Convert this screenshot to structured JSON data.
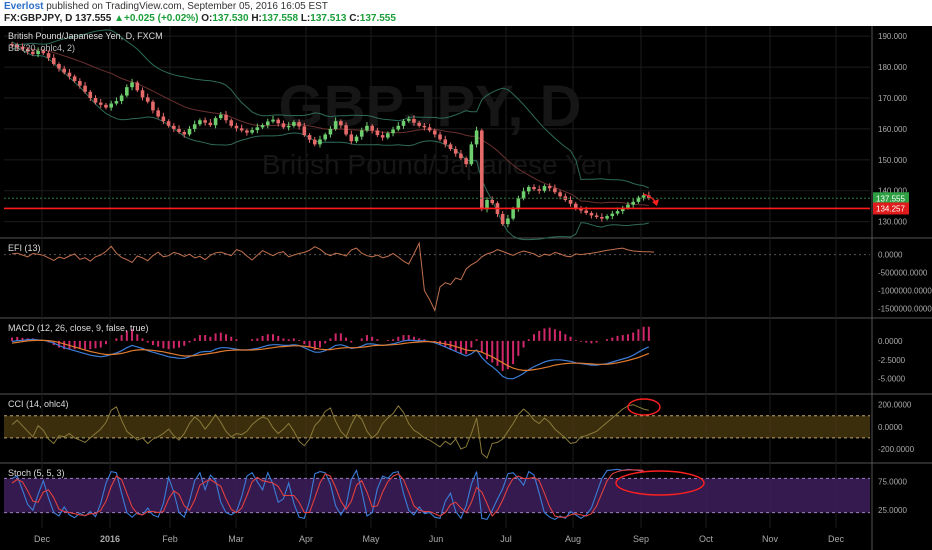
{
  "header": {
    "author": "Everlost",
    "published": "published on TradingView.com, September 05, 2016 16:05 EST",
    "symbol": "FX:GBPJPY, D",
    "last": "137.555",
    "change_arrow": "▲",
    "change": "+0.025 (+0.02%)",
    "o_label": "O:",
    "o": "137.530",
    "h_label": "H:",
    "h": "137.558",
    "l_label": "L:",
    "l": "137.513",
    "c_label": "C:",
    "c": "137.555"
  },
  "colors": {
    "background": "#000000",
    "up_candle": "#6fcf6f",
    "down_candle": "#e56a6a",
    "support_line": "#ff1a1a",
    "price_badge": "#2ea043",
    "support_badge": "#e01b1b",
    "macd_line": "#3b7dd8",
    "signal_line": "#e07a2e",
    "hist": "#d0286a",
    "cci_band": "#4a3a10",
    "stoch_band": "#3d1f5c",
    "annotation": "#ff2020"
  },
  "chart_data": [
    {
      "type": "candlestick",
      "title": "British Pound/Japanese Yen, D, FXCM",
      "watermark_symbol": "GBPJPY, D",
      "watermark_name": "British Pound/Japanese Yen",
      "indicator_label": "BB (20, ohlc4, 2)",
      "x_ticks": [
        "Dec",
        "2016",
        "Feb",
        "Mar",
        "Apr",
        "May",
        "Jun",
        "Jul",
        "Aug",
        "Sep",
        "Oct",
        "Nov",
        "Dec"
      ],
      "y_ticks": [
        "190.000",
        "180.000",
        "170.000",
        "160.000",
        "150.000",
        "140.000",
        "130.000"
      ],
      "ylim": [
        126,
        192
      ],
      "last_price_label": "137.555",
      "support_level": 134.257,
      "support_label": "134.257",
      "close": [
        187,
        186.5,
        185.8,
        185,
        184.2,
        185.2,
        184.5,
        183,
        181,
        179.5,
        178.2,
        177,
        175.5,
        174,
        172,
        170,
        168.5,
        167.8,
        166.9,
        168.2,
        169,
        170.8,
        173.5,
        175,
        172.5,
        170.2,
        168.8,
        166,
        164,
        162.5,
        161,
        160,
        159,
        158.2,
        160,
        161.5,
        162.8,
        162,
        161.2,
        163.5,
        164.6,
        162.8,
        161,
        160.2,
        159.5,
        158.8,
        159.6,
        160.5,
        161.2,
        162.4,
        163,
        161.8,
        160.5,
        161,
        162.2,
        160.8,
        158,
        156.5,
        155,
        156.6,
        158.2,
        160,
        162.5,
        161.2,
        158.2,
        156,
        157.5,
        159.5,
        161,
        159.5,
        158,
        157.2,
        158.6,
        159.8,
        161,
        162.6,
        163.2,
        162,
        161,
        160.5,
        159.5,
        158.2,
        156.6,
        155,
        153.5,
        152,
        150.5,
        148.6,
        155,
        159.5,
        134,
        137,
        136,
        132.5,
        129.2,
        131,
        134.2,
        137.5,
        139.8,
        141.2,
        140.5,
        140,
        141.5,
        140.8,
        139.5,
        138.2,
        137,
        135.8,
        134.2,
        133.6,
        132.8,
        132,
        131.5,
        131,
        131.8,
        132.6,
        133.4,
        134.5,
        135.5,
        136.4,
        137.8,
        138.5,
        137.555
      ]
    },
    {
      "type": "line",
      "title": "EFI (13)",
      "y_ticks": [
        "0.0000",
        "-500000.0000",
        "-1000000.0000",
        "-1500000.0000"
      ],
      "ylim": [
        -1650000,
        350000
      ],
      "values": [
        20000,
        40000,
        -10000,
        -60000,
        30000,
        10000,
        -20000,
        -90000,
        -160000,
        -70000,
        -110000,
        -40000,
        20000,
        -130000,
        -90000,
        -180000,
        -60000,
        -10000,
        90000,
        230000,
        40000,
        -80000,
        -140000,
        -220000,
        -40000,
        -90000,
        -170000,
        -30000,
        70000,
        -60000,
        -30000,
        60000,
        20000,
        -50000,
        10000,
        -90000,
        -50000,
        -140000,
        -20000,
        50000,
        70000,
        20000,
        -30000,
        140000,
        90000,
        -40000,
        -150000,
        -20000,
        110000,
        40000,
        -30000,
        50000,
        80000,
        -60000,
        -10000,
        30000,
        60000,
        120000,
        220000,
        150000,
        30000,
        -30000,
        40000,
        10000,
        -40000,
        130000,
        180000,
        40000,
        -30000,
        -60000,
        -10000,
        -90000,
        -50000,
        30000,
        -70000,
        -180000,
        -260000,
        20000,
        320000,
        -1000000,
        -1250000,
        -1550000,
        -900000,
        -780000,
        -830000,
        -650000,
        -700000,
        -400000,
        -280000,
        -200000,
        -60000,
        20000,
        60000,
        140000,
        90000,
        30000,
        -20000,
        50000,
        100000,
        60000,
        20000,
        -60000,
        10000,
        -20000,
        60000,
        20000,
        -40000,
        -60000,
        20000,
        0,
        20000,
        40000,
        60000,
        90000,
        120000,
        140000,
        160000,
        180000,
        130000,
        100000,
        90000,
        80000,
        80000,
        70000
      ]
    },
    {
      "type": "line",
      "title": "MACD (12, 26, close, 9, false, true)",
      "y_ticks": [
        "0.0000",
        "-2.5000",
        "-5.0000"
      ],
      "ylim": [
        -6.5,
        2.5
      ],
      "series": [
        {
          "name": "MACD",
          "values": [
            -0.1,
            0.04,
            0.08,
            0.16,
            0.2,
            0.12,
            0.08,
            -0.06,
            -0.3,
            -0.6,
            -0.9,
            -1.1,
            -1.3,
            -1.5,
            -1.7,
            -1.9,
            -2.0,
            -2.1,
            -2.0,
            -1.8,
            -1.6,
            -1.3,
            -0.9,
            -0.6,
            -0.8,
            -1.0,
            -1.3,
            -1.5,
            -1.7,
            -1.9,
            -2.1,
            -2.2,
            -2.3,
            -2.3,
            -2.1,
            -1.8,
            -1.5,
            -1.4,
            -1.4,
            -1.1,
            -0.9,
            -0.9,
            -1.0,
            -1.1,
            -1.2,
            -1.2,
            -1.1,
            -1.0,
            -0.8,
            -0.6,
            -0.5,
            -0.5,
            -0.6,
            -0.6,
            -0.5,
            -0.6,
            -0.9,
            -1.2,
            -1.5,
            -1.5,
            -1.3,
            -1.0,
            -0.6,
            -0.5,
            -0.7,
            -1.0,
            -0.9,
            -0.7,
            -0.4,
            -0.4,
            -0.5,
            -0.6,
            -0.5,
            -0.4,
            -0.2,
            0.0,
            0.1,
            0.05,
            0.0,
            0.0,
            -0.1,
            -0.25,
            -0.5,
            -0.8,
            -1.1,
            -1.4,
            -1.7,
            -2.0,
            -1.7,
            -1.2,
            -2.2,
            -2.9,
            -3.4,
            -4.0,
            -4.7,
            -5.0,
            -5.0,
            -4.7,
            -4.3,
            -3.8,
            -3.4,
            -3.1,
            -2.8,
            -2.6,
            -2.5,
            -2.5,
            -2.6,
            -2.7,
            -2.9,
            -3.0,
            -3.1,
            -3.2,
            -3.2,
            -3.1,
            -3.0,
            -2.8,
            -2.6,
            -2.4,
            -2.2,
            -1.9,
            -1.5,
            -1.1,
            -0.8
          ]
        },
        {
          "name": "Signal",
          "values": [
            -0.3,
            -0.2,
            -0.1,
            0.0,
            0.05,
            0.06,
            0.06,
            0.04,
            -0.05,
            -0.2,
            -0.4,
            -0.6,
            -0.8,
            -1.0,
            -1.2,
            -1.4,
            -1.55,
            -1.7,
            -1.8,
            -1.8,
            -1.75,
            -1.65,
            -1.5,
            -1.3,
            -1.2,
            -1.15,
            -1.2,
            -1.25,
            -1.35,
            -1.45,
            -1.6,
            -1.75,
            -1.9,
            -2.0,
            -2.0,
            -1.95,
            -1.85,
            -1.75,
            -1.65,
            -1.55,
            -1.4,
            -1.3,
            -1.25,
            -1.2,
            -1.2,
            -1.2,
            -1.2,
            -1.15,
            -1.1,
            -1.0,
            -0.9,
            -0.8,
            -0.75,
            -0.7,
            -0.65,
            -0.65,
            -0.7,
            -0.8,
            -0.95,
            -1.1,
            -1.15,
            -1.15,
            -1.05,
            -0.95,
            -0.9,
            -0.9,
            -0.9,
            -0.85,
            -0.75,
            -0.65,
            -0.6,
            -0.6,
            -0.55,
            -0.5,
            -0.45,
            -0.35,
            -0.25,
            -0.2,
            -0.15,
            -0.1,
            -0.1,
            -0.15,
            -0.25,
            -0.4,
            -0.55,
            -0.75,
            -0.95,
            -1.2,
            -1.3,
            -1.3,
            -1.5,
            -1.8,
            -2.1,
            -2.5,
            -2.9,
            -3.3,
            -3.6,
            -3.8,
            -3.9,
            -3.9,
            -3.8,
            -3.7,
            -3.55,
            -3.4,
            -3.2,
            -3.1,
            -3.0,
            -2.95,
            -2.95,
            -2.95,
            -3.0,
            -3.05,
            -3.1,
            -3.1,
            -3.1,
            -3.0,
            -2.9,
            -2.75,
            -2.6,
            -2.4,
            -2.2,
            -1.95,
            -1.65
          ]
        }
      ]
    },
    {
      "type": "line",
      "title": "CCI (14, ohlc4)",
      "y_ticks": [
        "200.0000",
        "0.0000",
        "-200.0000"
      ],
      "ylim": [
        -290,
        260
      ],
      "band": [
        -100,
        100
      ],
      "values": [
        20,
        60,
        10,
        -40,
        -90,
        10,
        -30,
        -110,
        -150,
        -80,
        -90,
        -60,
        -100,
        -120,
        -140,
        -100,
        -60,
        -20,
        40,
        150,
        180,
        60,
        -40,
        -80,
        -120,
        -100,
        -150,
        -110,
        -90,
        -60,
        -20,
        -80,
        -120,
        -60,
        30,
        90,
        50,
        -20,
        40,
        110,
        40,
        -40,
        -90,
        -60,
        -70,
        -40,
        20,
        60,
        90,
        70,
        -10,
        -60,
        -20,
        30,
        -40,
        -130,
        -170,
        -110,
        10,
        60,
        140,
        170,
        50,
        -40,
        -90,
        20,
        110,
        70,
        -40,
        -100,
        -60,
        30,
        80,
        120,
        190,
        130,
        30,
        -30,
        -60,
        -100,
        -120,
        -150,
        -180,
        -130,
        -160,
        -110,
        -200,
        -180,
        -60,
        80,
        -240,
        -280,
        -150,
        -140,
        -110,
        -40,
        30,
        110,
        160,
        120,
        60,
        30,
        80,
        40,
        -20,
        -60,
        -100,
        -150,
        -140,
        -90,
        -80,
        -60,
        -40,
        0,
        40,
        80,
        120,
        160,
        190,
        200,
        180,
        160,
        150
      ]
    },
    {
      "type": "line",
      "title": "Stoch (5, 5, 3)",
      "y_ticks": [
        "75.0000",
        "25.0000"
      ],
      "ylim": [
        0,
        100
      ],
      "band": [
        20,
        80
      ],
      "series": [
        {
          "name": "%K",
          "values": [
            80,
            84,
            60,
            34,
            24,
            52,
            76,
            46,
            20,
            14,
            30,
            16,
            11,
            19,
            14,
            22,
            13,
            36,
            72,
            92,
            90,
            54,
            20,
            12,
            20,
            16,
            28,
            16,
            12,
            36,
            82,
            56,
            20,
            12,
            40,
            76,
            90,
            60,
            86,
            76,
            38,
            20,
            16,
            22,
            48,
            84,
            90,
            74,
            60,
            90,
            70,
            38,
            44,
            72,
            36,
            12,
            10,
            40,
            88,
            92,
            90,
            70,
            32,
            16,
            32,
            78,
            94,
            58,
            14,
            20,
            62,
            84,
            80,
            90,
            92,
            54,
            24,
            16,
            30,
            18,
            20,
            12,
            10,
            40,
            54,
            22,
            10,
            32,
            70,
            92,
            10,
            8,
            24,
            44,
            62,
            88,
            90,
            80,
            68,
            92,
            86,
            54,
            20,
            12,
            8,
            14,
            10,
            22,
            16,
            10,
            16,
            28,
            54,
            80,
            94,
            95,
            96,
            94,
            96,
            95,
            94,
            92
          ]
        },
        {
          "name": "%D",
          "values": [
            72,
            78,
            74,
            58,
            40,
            38,
            56,
            60,
            46,
            26,
            22,
            20,
            18,
            16,
            15,
            18,
            18,
            24,
            40,
            66,
            84,
            78,
            54,
            30,
            18,
            16,
            22,
            22,
            20,
            22,
            44,
            58,
            52,
            32,
            24,
            42,
            68,
            74,
            78,
            72,
            66,
            44,
            26,
            20,
            28,
            50,
            74,
            82,
            76,
            74,
            72,
            66,
            50,
            50,
            50,
            38,
            20,
            20,
            46,
            72,
            88,
            84,
            64,
            40,
            26,
            40,
            68,
            76,
            56,
            30,
            32,
            56,
            74,
            84,
            88,
            78,
            56,
            32,
            24,
            22,
            22,
            18,
            14,
            20,
            34,
            38,
            28,
            20,
            38,
            64,
            56,
            36,
            14,
            24,
            42,
            64,
            80,
            84,
            80,
            80,
            82,
            76,
            54,
            30,
            14,
            12,
            12,
            16,
            18,
            16,
            14,
            18,
            32,
            54,
            76,
            88,
            92,
            94,
            95,
            95,
            95,
            94
          ]
        }
      ]
    }
  ]
}
